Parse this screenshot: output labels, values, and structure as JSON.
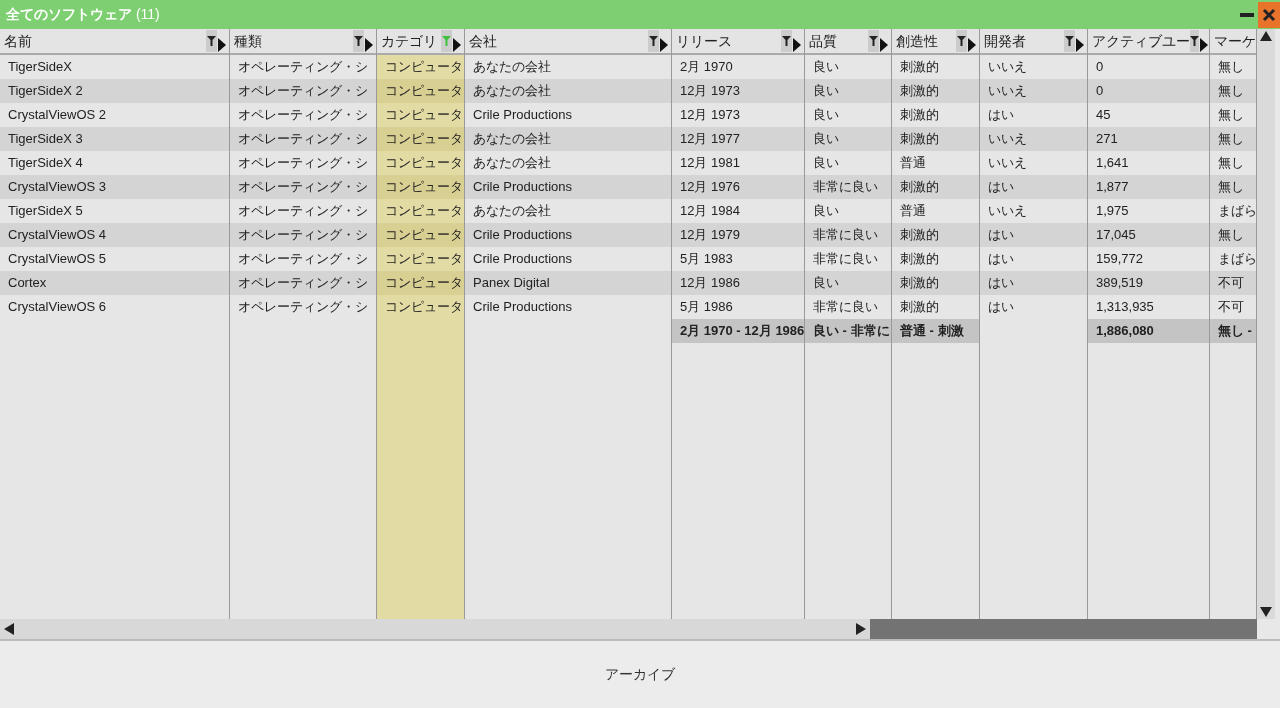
{
  "window": {
    "title": "全てのソフトウェア",
    "count": "(11)"
  },
  "columns": [
    {
      "label": "名前",
      "filtered": false
    },
    {
      "label": "種類",
      "filtered": false
    },
    {
      "label": "カテゴリ",
      "filtered": true
    },
    {
      "label": "会社",
      "filtered": false
    },
    {
      "label": "リリース",
      "filtered": false,
      "summary": "2月 1970 - 12月 1986"
    },
    {
      "label": "品質",
      "filtered": false,
      "summary": "良い - 非常に"
    },
    {
      "label": "創造性",
      "filtered": false,
      "summary": "普通 - 刺激"
    },
    {
      "label": "開発者",
      "filtered": false
    },
    {
      "label": "アクティブユー",
      "filtered": false,
      "summary": "1,886,080"
    },
    {
      "label": "マーケ",
      "summary": "無し -"
    }
  ],
  "rows": [
    [
      "TigerSideX",
      "オペレーティング・シ",
      "コンピュータ",
      "あなたの会社",
      "2月 1970",
      "良い",
      "刺激的",
      "いいえ",
      "0",
      "無し"
    ],
    [
      "TigerSideX 2",
      "オペレーティング・シ",
      "コンピュータ",
      "あなたの会社",
      "12月 1973",
      "良い",
      "刺激的",
      "いいえ",
      "0",
      "無し"
    ],
    [
      "CrystalViewOS 2",
      "オペレーティング・シ",
      "コンピュータ",
      "Crile Productions",
      "12月 1973",
      "良い",
      "刺激的",
      "はい",
      "45",
      "無し"
    ],
    [
      "TigerSideX 3",
      "オペレーティング・シ",
      "コンピュータ",
      "あなたの会社",
      "12月 1977",
      "良い",
      "刺激的",
      "いいえ",
      "271",
      "無し"
    ],
    [
      "TigerSideX 4",
      "オペレーティング・シ",
      "コンピュータ",
      "あなたの会社",
      "12月 1981",
      "良い",
      "普通",
      "いいえ",
      "1,641",
      "無し"
    ],
    [
      "CrystalViewOS 3",
      "オペレーティング・シ",
      "コンピュータ",
      "Crile Productions",
      "12月 1976",
      "非常に良い",
      "刺激的",
      "はい",
      "1,877",
      "無し"
    ],
    [
      "TigerSideX 5",
      "オペレーティング・シ",
      "コンピュータ",
      "あなたの会社",
      "12月 1984",
      "良い",
      "普通",
      "いいえ",
      "1,975",
      "まばら"
    ],
    [
      "CrystalViewOS 4",
      "オペレーティング・シ",
      "コンピュータ",
      "Crile Productions",
      "12月 1979",
      "非常に良い",
      "刺激的",
      "はい",
      "17,045",
      "無し"
    ],
    [
      "CrystalViewOS 5",
      "オペレーティング・シ",
      "コンピュータ",
      "Crile Productions",
      "5月 1983",
      "非常に良い",
      "刺激的",
      "はい",
      "159,772",
      "まばら"
    ],
    [
      "Cortex",
      "オペレーティング・シ",
      "コンピュータ",
      "Panex Digital",
      "12月 1986",
      "良い",
      "刺激的",
      "はい",
      "389,519",
      "不可"
    ],
    [
      "CrystalViewOS 6",
      "オペレーティング・シ",
      "コンピュータ",
      "Crile Productions",
      "5月 1986",
      "非常に良い",
      "刺激的",
      "はい",
      "1,313,935",
      "不可"
    ]
  ],
  "footer_button": "アーカイブ"
}
